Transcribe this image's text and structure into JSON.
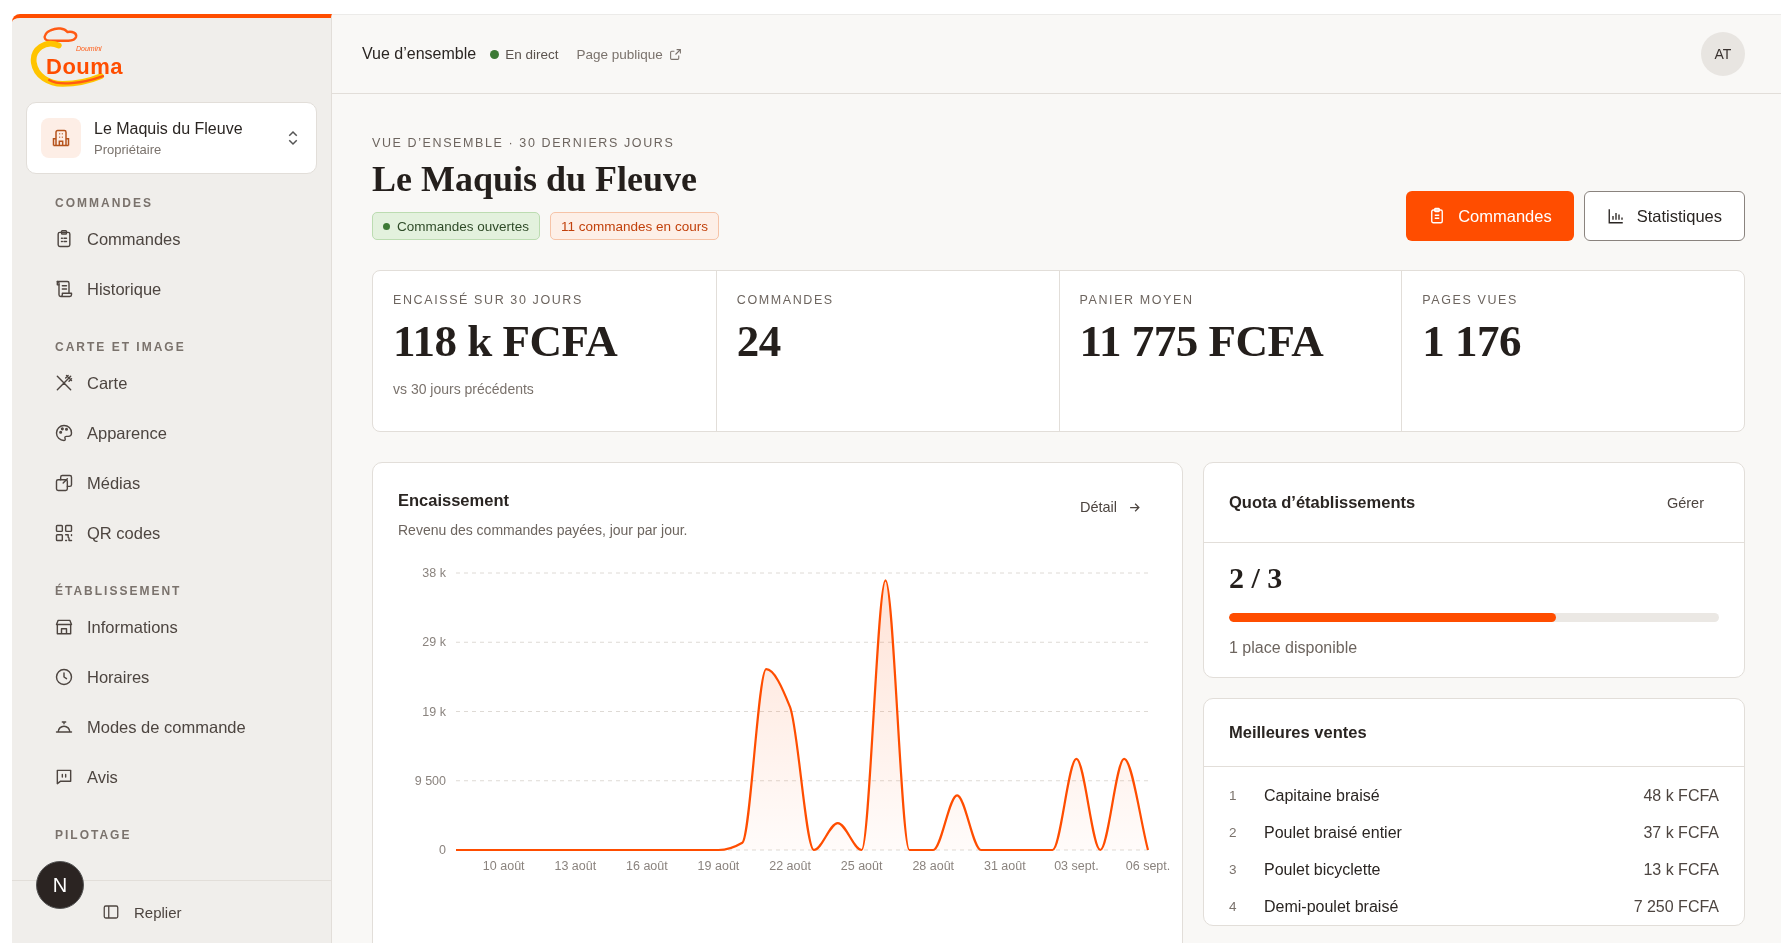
{
  "sidebar": {
    "logo": {
      "tagline": "Doumini",
      "name": "Douma"
    },
    "establishment": {
      "name": "Le Maquis du Fleuve",
      "role": "Propriétaire"
    },
    "sections": [
      {
        "title": "COMMANDES",
        "items": [
          {
            "label": "Commandes",
            "selected": false
          },
          {
            "label": "Historique",
            "selected": false
          }
        ]
      },
      {
        "title": "CARTE ET IMAGE",
        "items": [
          {
            "label": "Carte",
            "selected": false
          },
          {
            "label": "Apparence",
            "selected": false
          },
          {
            "label": "Médias",
            "selected": false
          },
          {
            "label": "QR codes",
            "selected": false
          }
        ]
      },
      {
        "title": "ÉTABLISSEMENT",
        "items": [
          {
            "label": "Informations",
            "selected": false
          },
          {
            "label": "Horaires",
            "selected": false
          },
          {
            "label": "Modes de commande",
            "selected": false
          },
          {
            "label": "Avis",
            "selected": false
          }
        ]
      },
      {
        "title": "PILOTAGE"
      }
    ],
    "collapse": "Replier",
    "dev_badge": "N"
  },
  "header": {
    "title": "Vue d’ensemble",
    "status": {
      "label": "En direct",
      "color": "#3d7a35"
    },
    "public_link": "Page publique",
    "avatar": "AT"
  },
  "page": {
    "eyebrow": "VUE D’ENSEMBLE · 30 DERNIERS JOURS",
    "title": "Le Maquis du Fleuve",
    "badges": [
      {
        "label": "Commandes ouvertes",
        "kind": "success"
      },
      {
        "label": "11 commandes en cours",
        "kind": "warning"
      }
    ],
    "buttons": [
      {
        "label": "Commandes",
        "kind": "primary"
      },
      {
        "label": "Statistiques",
        "kind": "secondary"
      }
    ]
  },
  "stats": [
    {
      "label": "ENCAISSÉ SUR 30 JOURS",
      "value": "118 k FCFA",
      "note": "vs 30 jours précédents"
    },
    {
      "label": "COMMANDES",
      "value": "24"
    },
    {
      "label": "PANIER MOYEN",
      "value": "11 775 FCFA"
    },
    {
      "label": "PAGES VUES",
      "value": "1 176"
    }
  ],
  "revenue": {
    "title": "Encaissement",
    "subtitle": "Revenu des commandes payées, jour par jour.",
    "link": "Détail",
    "chart_data": {
      "type": "area",
      "categories": [
        null,
        null,
        "10 août",
        null,
        null,
        "13 août",
        null,
        null,
        "16 août",
        null,
        null,
        "19 août",
        null,
        null,
        "22 août",
        null,
        null,
        "25 août",
        null,
        null,
        "28 août",
        null,
        null,
        "31 août",
        null,
        null,
        "03 sept.",
        null,
        null,
        "06 sept."
      ],
      "series": [
        {
          "color": "#ff4d00",
          "values": [
            0,
            0,
            0,
            0,
            0,
            0,
            0,
            0,
            0,
            0,
            0,
            0,
            1000,
            24800,
            19600,
            0,
            3700,
            0,
            37000,
            0,
            0,
            7500,
            0,
            0,
            0,
            0,
            12500,
            0,
            12500,
            0
          ]
        }
      ],
      "ylim": [
        0,
        38000
      ],
      "grid": true,
      "yticks": [
        {
          "value": 0,
          "label": "0"
        },
        {
          "value": 9500,
          "label": "9 500"
        },
        {
          "value": 19000,
          "label": "19 k"
        },
        {
          "value": 28500,
          "label": "29 k"
        },
        {
          "value": 38000,
          "label": "38 k"
        }
      ]
    }
  },
  "quota": {
    "title": "Quota d’établissements",
    "link": "Gérer",
    "value": "2 / 3",
    "level": 0.667,
    "note": "1 place disponible"
  },
  "best_sellers": {
    "title": "Meilleures ventes",
    "rows": [
      {
        "rank": "1",
        "name": "Capitaine braisé",
        "amount": "48 k FCFA"
      },
      {
        "rank": "2",
        "name": "Poulet braisé entier",
        "amount": "37 k FCFA"
      },
      {
        "rank": "3",
        "name": "Poulet bicyclette",
        "amount": "13 k FCFA"
      },
      {
        "rank": "4",
        "name": "Demi-poulet braisé",
        "amount": "7 250 FCFA"
      }
    ]
  }
}
